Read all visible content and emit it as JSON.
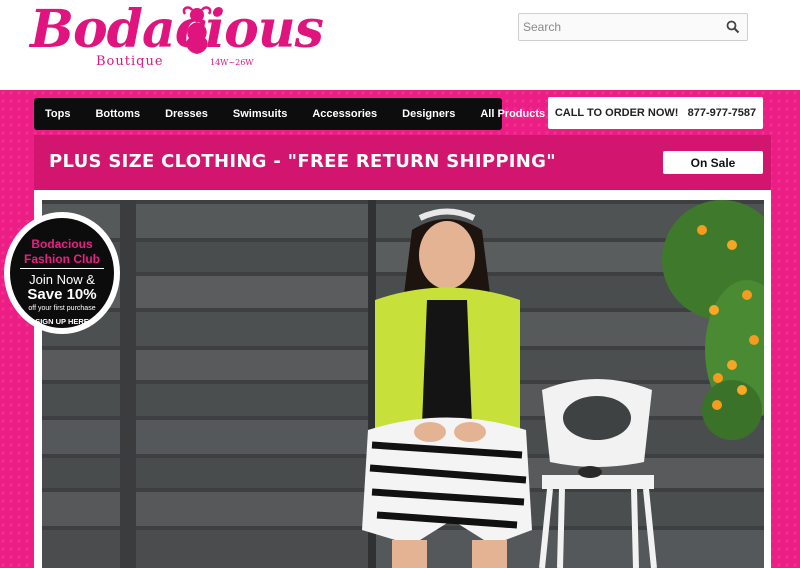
{
  "header": {
    "logo": {
      "main": "Bodacious",
      "sub": "Boutique",
      "sizes": "14W~26W"
    },
    "search": {
      "placeholder": "Search",
      "icon": "magnifier-icon"
    }
  },
  "nav": {
    "items": [
      {
        "label": "Tops"
      },
      {
        "label": "Bottoms"
      },
      {
        "label": "Dresses"
      },
      {
        "label": "Swimsuits"
      },
      {
        "label": "Accessories"
      },
      {
        "label": "Designers"
      },
      {
        "label": "All Products"
      }
    ]
  },
  "order": {
    "text": "CALL TO ORDER NOW!   877-977-7587"
  },
  "banner": {
    "title": "PLUS SIZE CLOTHING - \"FREE RETURN SHIPPING\"",
    "sale_button": "On Sale"
  },
  "club": {
    "title_line1": "Bodacious",
    "title_line2": "Fashion Club",
    "join": "Join Now &",
    "save": "Save 10%",
    "off": "off your first purchase",
    "sign_up": "SIGN UP HERE"
  },
  "colors": {
    "brand_pink": "#ec1e86",
    "banner_pink": "#d2166f",
    "nav_black": "#0d0d0d"
  }
}
